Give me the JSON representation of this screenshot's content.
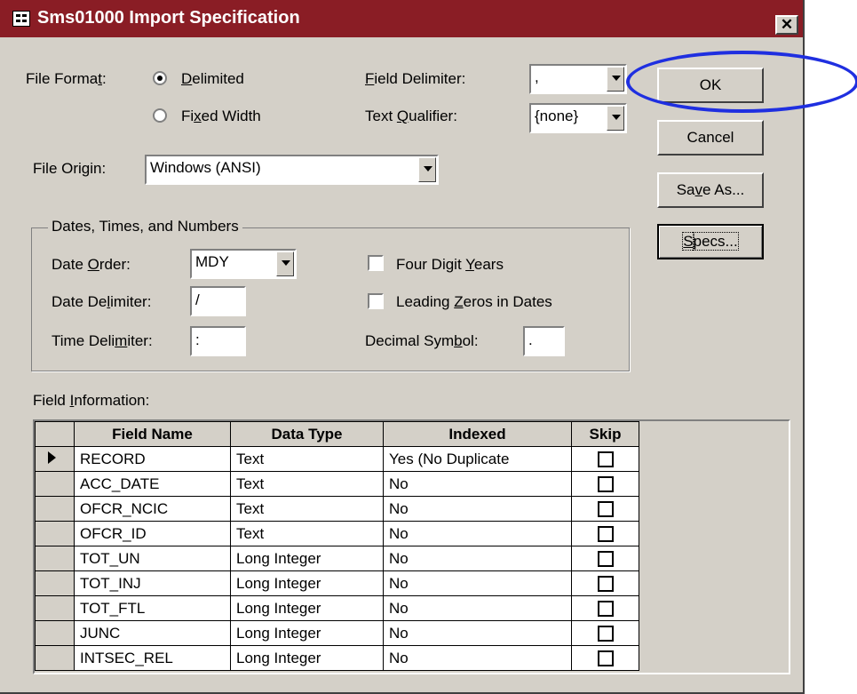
{
  "window": {
    "title": "Sms01000 Import Specification",
    "close_glyph": "✕"
  },
  "file_format": {
    "label_pre": "File Forma",
    "label_u": "t",
    "label_post": ":",
    "delimited": {
      "pre": "",
      "u": "D",
      "post": "elimited",
      "selected": true
    },
    "fixed": {
      "pre": "Fi",
      "u": "x",
      "post": "ed Width",
      "selected": false
    }
  },
  "field_delimiter": {
    "pre": "",
    "u": "F",
    "post": "ield Delimiter:",
    "value": ","
  },
  "text_qualifier": {
    "pre": "Text ",
    "u": "Q",
    "post": "ualifier:",
    "value": "{none}"
  },
  "file_origin": {
    "label": "File Origin:",
    "value": "Windows (ANSI)"
  },
  "buttons": {
    "ok": "OK",
    "cancel": "Cancel",
    "save_as": {
      "pre": "Sa",
      "u": "v",
      "post": "e As..."
    },
    "specs": {
      "pre": "",
      "u": "S",
      "post": "pecs..."
    }
  },
  "dates_group": {
    "legend": "Dates, Times, and Numbers",
    "date_order": {
      "pre": "Date ",
      "u": "O",
      "post": "rder:",
      "value": "MDY"
    },
    "date_delimiter": {
      "pre": "Date De",
      "u": "l",
      "post": "imiter:",
      "value": "/"
    },
    "time_delimiter": {
      "pre": "Time Deli",
      "u": "m",
      "post": "iter:",
      "value": ":"
    },
    "four_digit_years": {
      "pre": "Four Digit ",
      "u": "Y",
      "post": "ears",
      "checked": false
    },
    "leading_zeros": {
      "pre": "Leading ",
      "u": "Z",
      "post": "eros in Dates",
      "checked": false
    },
    "decimal_symbol": {
      "pre": "Decimal Sym",
      "u": "b",
      "post": "ol:",
      "value": "."
    }
  },
  "field_info": {
    "label_pre": "Field ",
    "label_u": "I",
    "label_post": "nformation:",
    "columns": [
      "Field Name",
      "Data Type",
      "Indexed",
      "Skip"
    ],
    "rows": [
      {
        "name": "RECORD",
        "type": "Text",
        "indexed": "Yes (No Duplicate",
        "skip": false,
        "current": true
      },
      {
        "name": "ACC_DATE",
        "type": "Text",
        "indexed": "No",
        "skip": false
      },
      {
        "name": "OFCR_NCIC",
        "type": "Text",
        "indexed": "No",
        "skip": false
      },
      {
        "name": "OFCR_ID",
        "type": "Text",
        "indexed": "No",
        "skip": false
      },
      {
        "name": "TOT_UN",
        "type": "Long Integer",
        "indexed": "No",
        "skip": false
      },
      {
        "name": "TOT_INJ",
        "type": "Long Integer",
        "indexed": "No",
        "skip": false
      },
      {
        "name": "TOT_FTL",
        "type": "Long Integer",
        "indexed": "No",
        "skip": false
      },
      {
        "name": "JUNC",
        "type": "Long Integer",
        "indexed": "No",
        "skip": false
      },
      {
        "name": "INTSEC_REL",
        "type": "Long Integer",
        "indexed": "No",
        "skip": false
      }
    ]
  },
  "colors": {
    "title_bar": "#8a1d25",
    "dialog_bg": "#d4d0c8",
    "highlight": "#1f2fe0"
  }
}
